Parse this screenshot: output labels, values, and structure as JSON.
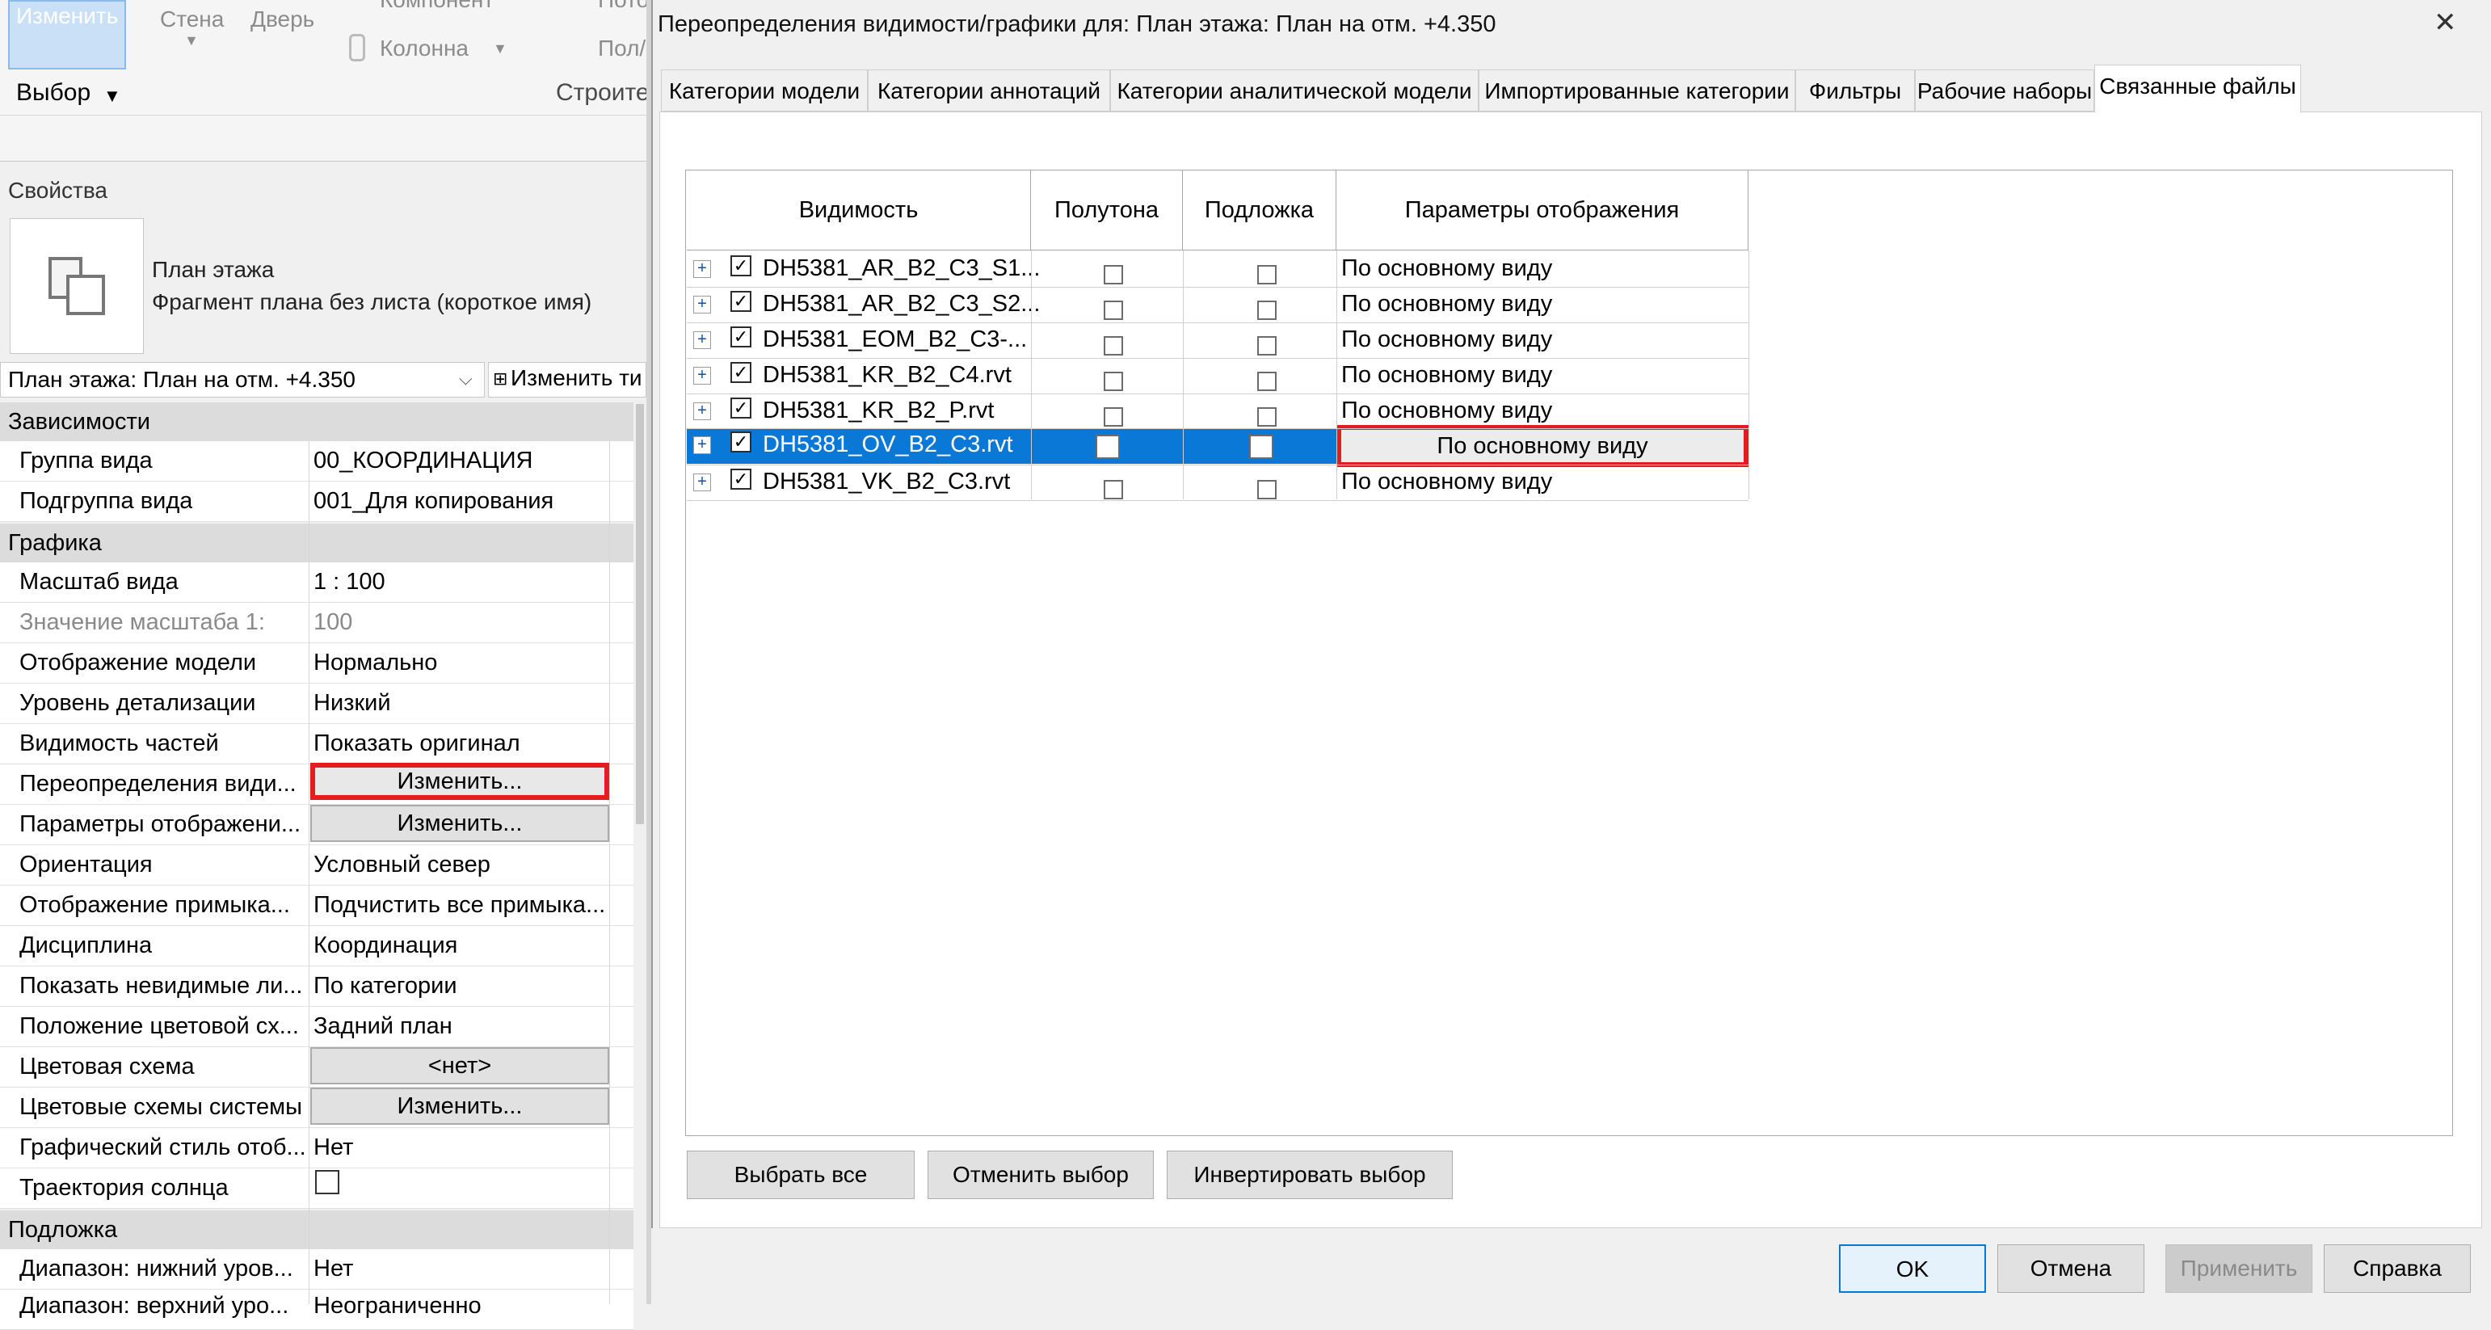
{
  "ribbon": {
    "modify": "Изменить",
    "select": "Выбор",
    "wall": "Стена",
    "door": "Дверь",
    "component": "Компонент",
    "column": "Колонна",
    "floor": "Пол/",
    "roof": "Пото",
    "build": "Строите"
  },
  "properties": {
    "title": "Свойства",
    "type_name": "План этажа",
    "type_sub": "Фрагмент плана без листа (короткое имя)",
    "view_selector": "План этажа: План на отм. +4.350",
    "edit_type": "Изменить ти",
    "sections": {
      "dependencies": "Зависимости",
      "graphics": "Графика",
      "underlay": "Подложка"
    },
    "rows": [
      {
        "label": "Группа вида",
        "value": "00_КООРДИНАЦИЯ"
      },
      {
        "label": "Подгруппа вида",
        "value": "001_Для копирования"
      },
      {
        "label": "Масштаб вида",
        "value": "1 : 100"
      },
      {
        "label": "Значение масштаба    1:",
        "value": "100"
      },
      {
        "label": "Отображение модели",
        "value": "Нормально"
      },
      {
        "label": "Уровень детализации",
        "value": "Низкий"
      },
      {
        "label": "Видимость частей",
        "value": "Показать оригинал"
      },
      {
        "label": "Переопределения види...",
        "value": "Изменить..."
      },
      {
        "label": "Параметры отображени...",
        "value": "Изменить..."
      },
      {
        "label": "Ориентация",
        "value": "Условный север"
      },
      {
        "label": "Отображение примыка...",
        "value": "Подчистить все примыка..."
      },
      {
        "label": "Дисциплина",
        "value": "Координация"
      },
      {
        "label": "Показать невидимые ли...",
        "value": "По категории"
      },
      {
        "label": "Положение цветовой сх...",
        "value": "Задний план"
      },
      {
        "label": "Цветовая схема",
        "value": "<нет>"
      },
      {
        "label": "Цветовые схемы системы",
        "value": "Изменить..."
      },
      {
        "label": "Графический стиль отоб...",
        "value": "Нет"
      },
      {
        "label": "Траектория солнца",
        "value": ""
      },
      {
        "label": "Диапазон: нижний уров...",
        "value": "Нет"
      },
      {
        "label": "Диапазон: верхний уро...",
        "value": "Неограниченно"
      }
    ]
  },
  "dialog": {
    "title": "Переопределения видимости/графики для: План этажа: План на отм. +4.350",
    "close": "✕",
    "tabs": [
      "Категории модели",
      "Категории аннотаций",
      "Категории аналитической модели",
      "Импортированные категории",
      "Фильтры",
      "Рабочие наборы",
      "Связанные файлы"
    ],
    "columns": [
      "Видимость",
      "Полутона",
      "Подложка",
      "Параметры отображения"
    ],
    "links": [
      {
        "name": "DH5381_AR_B2_C3_S1...",
        "display": "По основному виду"
      },
      {
        "name": "DH5381_AR_B2_C3_S2...",
        "display": "По основному виду"
      },
      {
        "name": "DH5381_EOM_B2_C3-...",
        "display": "По основному виду"
      },
      {
        "name": "DH5381_KR_B2_C4.rvt",
        "display": "По основному виду"
      },
      {
        "name": "DH5381_KR_B2_P.rvt",
        "display": "По основному виду"
      },
      {
        "name": "DH5381_OV_B2_C3.rvt",
        "display": "По основному виду"
      },
      {
        "name": "DH5381_VK_B2_C3.rvt",
        "display": "По основному виду"
      }
    ],
    "select_all": "Выбрать все",
    "select_none": "Отменить выбор",
    "invert": "Инвертировать выбор",
    "ok": "OK",
    "cancel": "Отмена",
    "apply": "Применить",
    "help": "Справка"
  },
  "colors": {
    "selection": "#0a78d7",
    "highlight": "#e31b23"
  }
}
